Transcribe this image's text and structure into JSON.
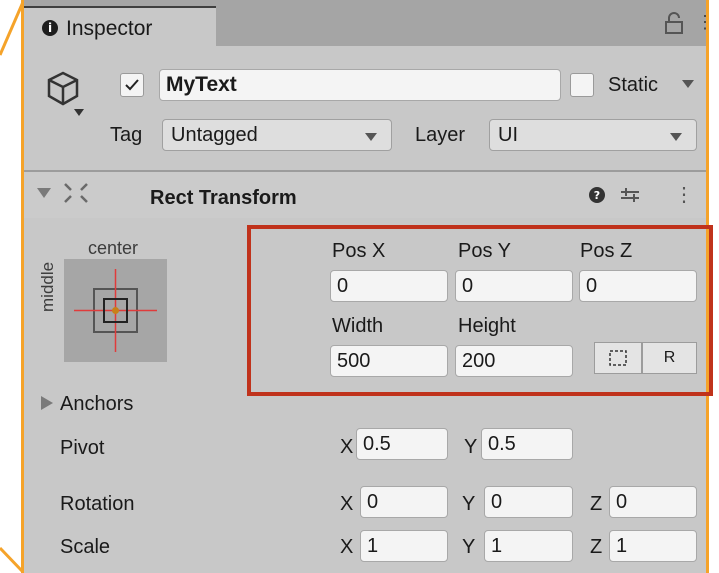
{
  "inspector": {
    "tab_label": "Inspector",
    "info_icon": "i"
  },
  "object": {
    "active": true,
    "name": "MyText",
    "static_label": "Static",
    "tag_label": "Tag",
    "tag_value": "Untagged",
    "layer_label": "Layer",
    "layer_value": "UI"
  },
  "rect_transform": {
    "title": "Rect Transform",
    "anchor_preset": {
      "horizontal": "center",
      "vertical": "middle"
    },
    "pos_x_label": "Pos X",
    "pos_y_label": "Pos Y",
    "pos_z_label": "Pos Z",
    "pos_x": "0",
    "pos_y": "0",
    "pos_z": "0",
    "width_label": "Width",
    "height_label": "Height",
    "width": "500",
    "height": "200",
    "raw_edit_button": "R",
    "anchors_label": "Anchors",
    "pivot_label": "Pivot",
    "pivot_x_label": "X",
    "pivot_x": "0.5",
    "pivot_y_label": "Y",
    "pivot_y": "0.5",
    "rotation_label": "Rotation",
    "rotation": {
      "x_label": "X",
      "x": "0",
      "y_label": "Y",
      "y": "0",
      "z_label": "Z",
      "z": "0"
    },
    "scale_label": "Scale",
    "scale": {
      "x_label": "X",
      "x": "1",
      "y_label": "Y",
      "y": "1",
      "z_label": "Z",
      "z": "1"
    }
  },
  "colors": {
    "highlight_outline": "#c0321b",
    "frame_accent": "#f5a32a",
    "panel_bg": "#c8c8c8"
  }
}
